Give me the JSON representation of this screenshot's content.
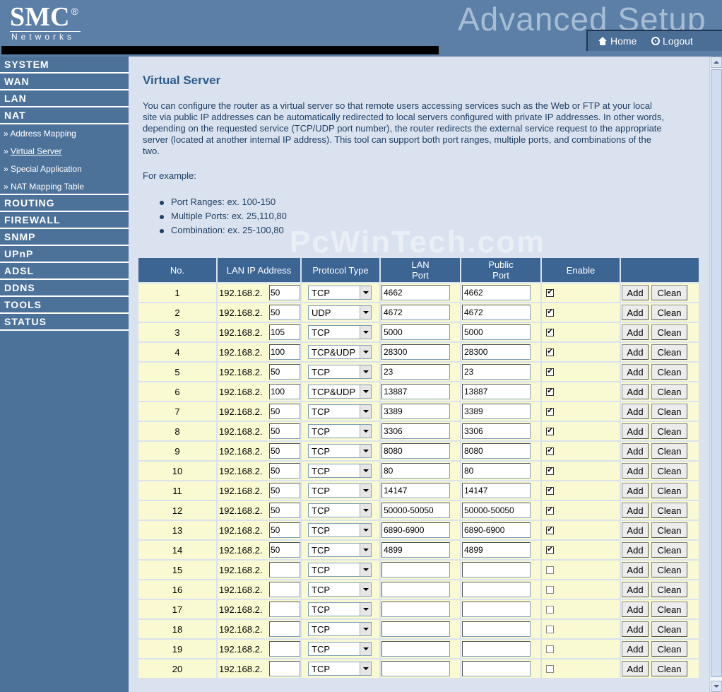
{
  "header": {
    "brand": "SMC",
    "brand_mark": "®",
    "brand_sub": "Networks",
    "page_banner": "Advanced Setup",
    "home_label": "Home",
    "logout_label": "Logout"
  },
  "sidebar": {
    "system": "SYSTEM",
    "wan": "WAN",
    "lan": "LAN",
    "nat": "NAT",
    "nat_sub": [
      "Address Mapping",
      "Virtual Server",
      "Special Application",
      "NAT Mapping Table"
    ],
    "nat_sub_prefix": "»",
    "routing": "ROUTING",
    "firewall": "FIREWALL",
    "snmp": "SNMP",
    "upnp": "UPnP",
    "adsl": "ADSL",
    "ddns": "DDNS",
    "tools": "TOOLS",
    "status": "STATUS"
  },
  "main": {
    "title": "Virtual Server",
    "description": "You can configure the router as a virtual server so that remote users accessing services such as the Web or FTP at your local site via public IP addresses can be automatically redirected to local servers configured with private IP addresses. In other words, depending on the requested service (TCP/UDP port number), the router redirects the external service request to the appropriate server (located at another internal IP address). This tool can support both port ranges, multiple ports, and combinations of the two.",
    "example_label": "For example:",
    "examples": [
      "Port Ranges: ex. 100-150",
      "Multiple Ports: ex. 25,110,80",
      "Combination: ex. 25-100,80"
    ],
    "watermark": "PcWinTech.com"
  },
  "table": {
    "headers": {
      "no": "No.",
      "lan_ip": "LAN IP Address",
      "protocol": "Protocol Type",
      "lan_port_1": "LAN",
      "lan_port_2": "Port",
      "public_port_1": "Public",
      "public_port_2": "Port",
      "enable": "Enable"
    },
    "ip_prefix": "192.168.2.",
    "add_label": "Add",
    "clean_label": "Clean",
    "rows": [
      {
        "no": "1",
        "ip": "50",
        "protocol": "TCP",
        "lan_port": "4662",
        "public_port": "4662",
        "enabled": true
      },
      {
        "no": "2",
        "ip": "50",
        "protocol": "UDP",
        "lan_port": "4672",
        "public_port": "4672",
        "enabled": true
      },
      {
        "no": "3",
        "ip": "105",
        "protocol": "TCP",
        "lan_port": "5000",
        "public_port": "5000",
        "enabled": true
      },
      {
        "no": "4",
        "ip": "100",
        "protocol": "TCP&UDP",
        "lan_port": "28300",
        "public_port": "28300",
        "enabled": true
      },
      {
        "no": "5",
        "ip": "50",
        "protocol": "TCP",
        "lan_port": "23",
        "public_port": "23",
        "enabled": true
      },
      {
        "no": "6",
        "ip": "100",
        "protocol": "TCP&UDP",
        "lan_port": "13887",
        "public_port": "13887",
        "enabled": true
      },
      {
        "no": "7",
        "ip": "50",
        "protocol": "TCP",
        "lan_port": "3389",
        "public_port": "3389",
        "enabled": true
      },
      {
        "no": "8",
        "ip": "50",
        "protocol": "TCP",
        "lan_port": "3306",
        "public_port": "3306",
        "enabled": true
      },
      {
        "no": "9",
        "ip": "50",
        "protocol": "TCP",
        "lan_port": "8080",
        "public_port": "8080",
        "enabled": true
      },
      {
        "no": "10",
        "ip": "50",
        "protocol": "TCP",
        "lan_port": "80",
        "public_port": "80",
        "enabled": true
      },
      {
        "no": "11",
        "ip": "50",
        "protocol": "TCP",
        "lan_port": "14147",
        "public_port": "14147",
        "enabled": true
      },
      {
        "no": "12",
        "ip": "50",
        "protocol": "TCP",
        "lan_port": "50000-50050",
        "public_port": "50000-50050",
        "enabled": true
      },
      {
        "no": "13",
        "ip": "50",
        "protocol": "TCP",
        "lan_port": "6890-6900",
        "public_port": "6890-6900",
        "enabled": true
      },
      {
        "no": "14",
        "ip": "50",
        "protocol": "TCP",
        "lan_port": "4899",
        "public_port": "4899",
        "enabled": true
      },
      {
        "no": "15",
        "ip": "",
        "protocol": "TCP",
        "lan_port": "",
        "public_port": "",
        "enabled": false
      },
      {
        "no": "16",
        "ip": "",
        "protocol": "TCP",
        "lan_port": "",
        "public_port": "",
        "enabled": false
      },
      {
        "no": "17",
        "ip": "",
        "protocol": "TCP",
        "lan_port": "",
        "public_port": "",
        "enabled": false
      },
      {
        "no": "18",
        "ip": "",
        "protocol": "TCP",
        "lan_port": "",
        "public_port": "",
        "enabled": false
      },
      {
        "no": "19",
        "ip": "",
        "protocol": "TCP",
        "lan_port": "",
        "public_port": "",
        "enabled": false
      },
      {
        "no": "20",
        "ip": "",
        "protocol": "TCP",
        "lan_port": "",
        "public_port": "",
        "enabled": false
      }
    ]
  },
  "colors": {
    "header_bg": "#5b7fa6",
    "sidebar_bg": "#4d729a",
    "content_bg": "#d9e2ee",
    "table_header_bg": "#3c6594",
    "row_bg": "#fafad2",
    "title_text": "#2c5a8a"
  }
}
